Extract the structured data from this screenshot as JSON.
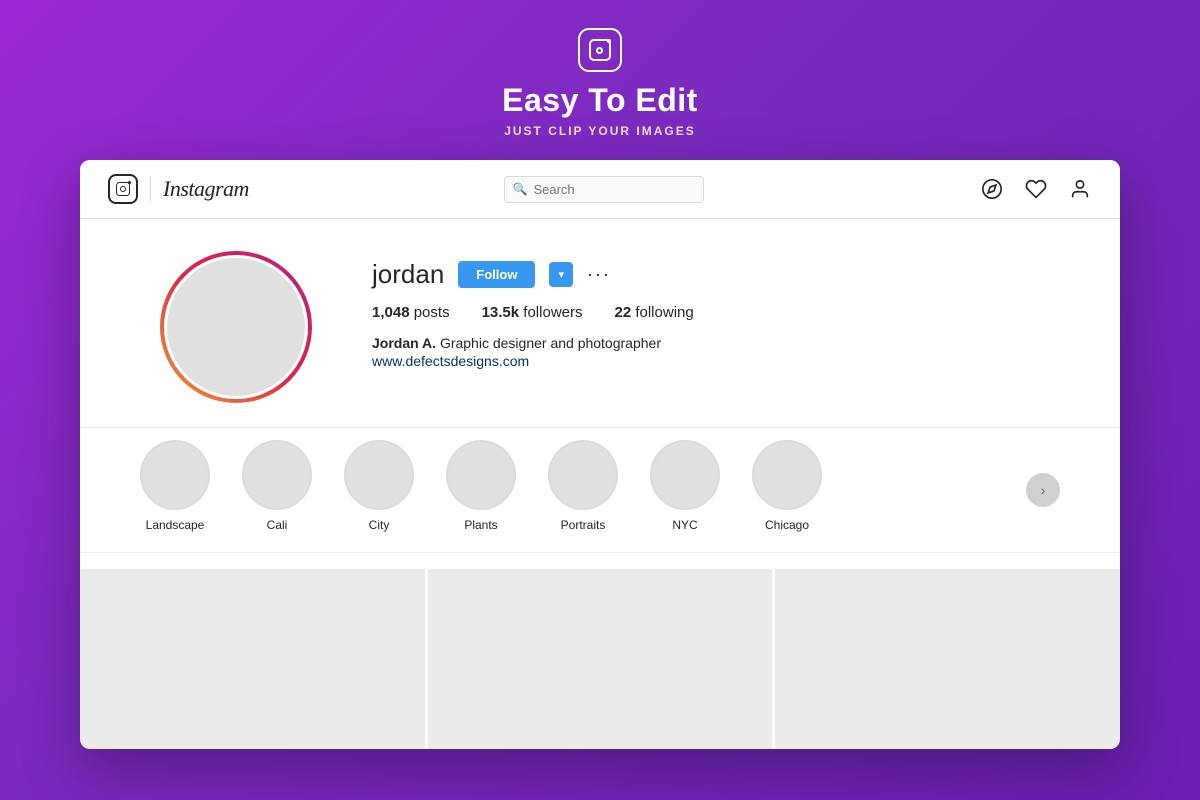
{
  "header": {
    "logo_alt": "Instagram Logo",
    "title": "Easy To Edit",
    "subtitle": "JUST CLIP YOUR IMAGES"
  },
  "navbar": {
    "wordmark": "Instagram",
    "search_placeholder": "Search"
  },
  "profile": {
    "username": "jordan",
    "follow_label": "Follow",
    "dropdown_label": "▾",
    "more_label": "···",
    "posts_count": "1,048",
    "posts_label": "posts",
    "followers_count": "13.5k",
    "followers_label": "followers",
    "following_count": "22",
    "following_label": "following",
    "full_name": "Jordan A.",
    "bio": "Graphic designer and photographer",
    "website": "www.defectsdesigns.com"
  },
  "highlights": [
    {
      "label": "Landscape"
    },
    {
      "label": "Cali"
    },
    {
      "label": "City"
    },
    {
      "label": "Plants"
    },
    {
      "label": "Portraits"
    },
    {
      "label": "NYC"
    },
    {
      "label": "Chicago"
    }
  ],
  "grid": [
    {
      "id": 1
    },
    {
      "id": 2
    },
    {
      "id": 3
    }
  ]
}
